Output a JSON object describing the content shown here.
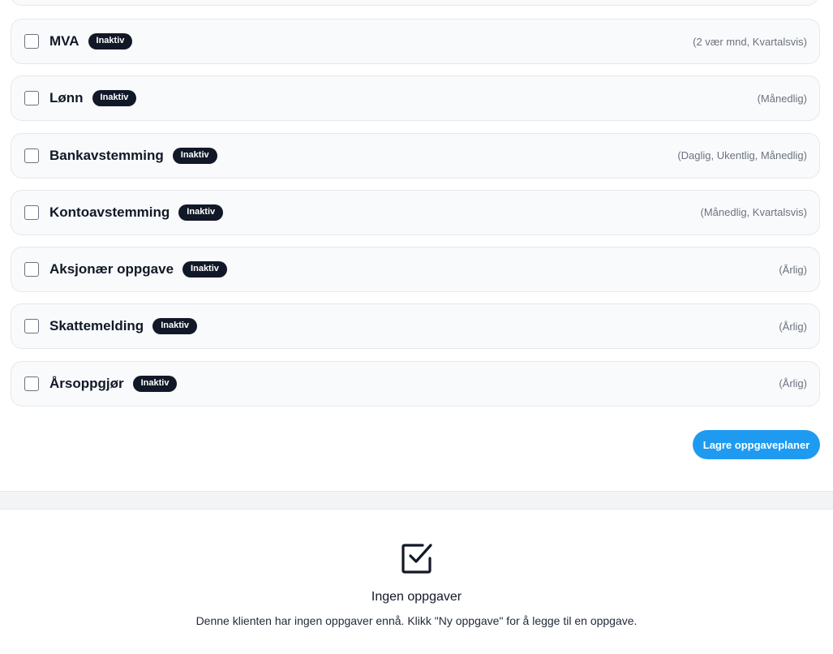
{
  "tasks": [
    {
      "name": "MVA",
      "badge": "Inaktiv",
      "frequency": "(2 vær mnd, Kvartalsvis)",
      "checked": false
    },
    {
      "name": "Lønn",
      "badge": "Inaktiv",
      "frequency": "(Månedlig)",
      "checked": false
    },
    {
      "name": "Bankavstemming",
      "badge": "Inaktiv",
      "frequency": "(Daglig, Ukentlig, Månedlig)",
      "checked": false
    },
    {
      "name": "Kontoavstemming",
      "badge": "Inaktiv",
      "frequency": "(Månedlig, Kvartalsvis)",
      "checked": false
    },
    {
      "name": "Aksjonær oppgave",
      "badge": "Inaktiv",
      "frequency": "(Årlig)",
      "checked": false
    },
    {
      "name": "Skattemelding",
      "badge": "Inaktiv",
      "frequency": "(Årlig)",
      "checked": false
    },
    {
      "name": "Årsoppgjør",
      "badge": "Inaktiv",
      "frequency": "(Årlig)",
      "checked": false
    }
  ],
  "save_button_label": "Lagre oppgaveplaner",
  "empty_state": {
    "icon": "checkbox-checked-icon",
    "title": "Ingen oppgaver",
    "description": "Denne klienten har ingen oppgaver ennå. Klikk \"Ny oppgave\" for å legge til en oppgave."
  },
  "colors": {
    "accent": "#1e9bf0",
    "badge_bg": "#111827",
    "row_bg": "#f9fafb",
    "row_border": "#e5e7eb"
  }
}
